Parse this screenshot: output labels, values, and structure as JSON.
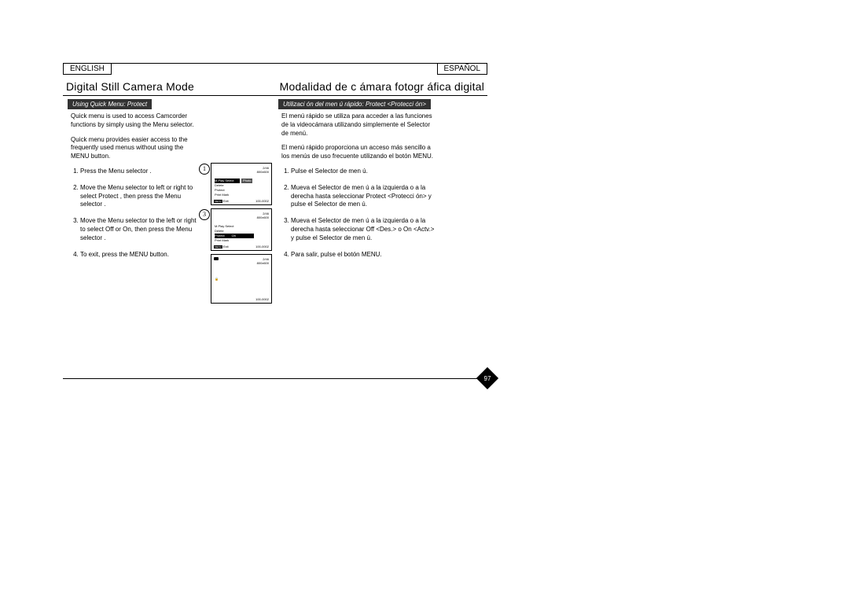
{
  "lang_left": "ENGLISH",
  "lang_right": "ESPAÑOL",
  "title_left": "Digital Still Camera Mode",
  "title_right": "Modalidad de c ámara fotogr áfica digital",
  "subhead_left": "Using Quick Menu: Protect",
  "subhead_right": "Utilizaci ón del men ú rápido: Protect <Protecci ón>",
  "intro_left_1": "Quick menu is used to access Camcorder functions by simply using the Menu selector.",
  "intro_left_2": "Quick menu provides easier access to the frequently used menus without using the MENU button.",
  "intro_right_1": "El menú rápido se utiliza para acceder a las funciones de la videocámara utilizando simplemente el Selector de menú.",
  "intro_right_2": "El menú rápido proporciona un acceso más sencillo a los menús de uso frecuente utilizando el botón MENU.",
  "steps_left": {
    "1": "Press the Menu selector .",
    "2": "Move the Menu selector  to left or right to select Protect , then press the Menu selector .",
    "3": "Move the Menu selector  to the left or right to select Off or On, then press the Menu selector .",
    "4": "To exit, press the MENU button."
  },
  "steps_right": {
    "1": "Pulse el Selector de men ú.",
    "2": "Mueva el Selector de men ú a la izquierda o a la derecha hasta seleccionar Protect <Protecci ón> y pulse el Selector de men ú.",
    "3": "Mueva el Selector de men ú a la izquierda o a la derecha hasta seleccionar Off <Des.> o On <Actv.>  y pulse el Selector de men ú.",
    "4": "Para salir, pulse el botón MENU."
  },
  "screen": {
    "counter": "2/46",
    "res": "800x600",
    "file": "100-0002",
    "items": {
      "mplay": "M.Play Select",
      "photo": "Photo",
      "delete": "Delete",
      "protect": "Protect",
      "on": "On",
      "printmark": "Print Mark"
    },
    "menu_badge": "MENU",
    "exit": "Exit"
  },
  "page_number": "97"
}
